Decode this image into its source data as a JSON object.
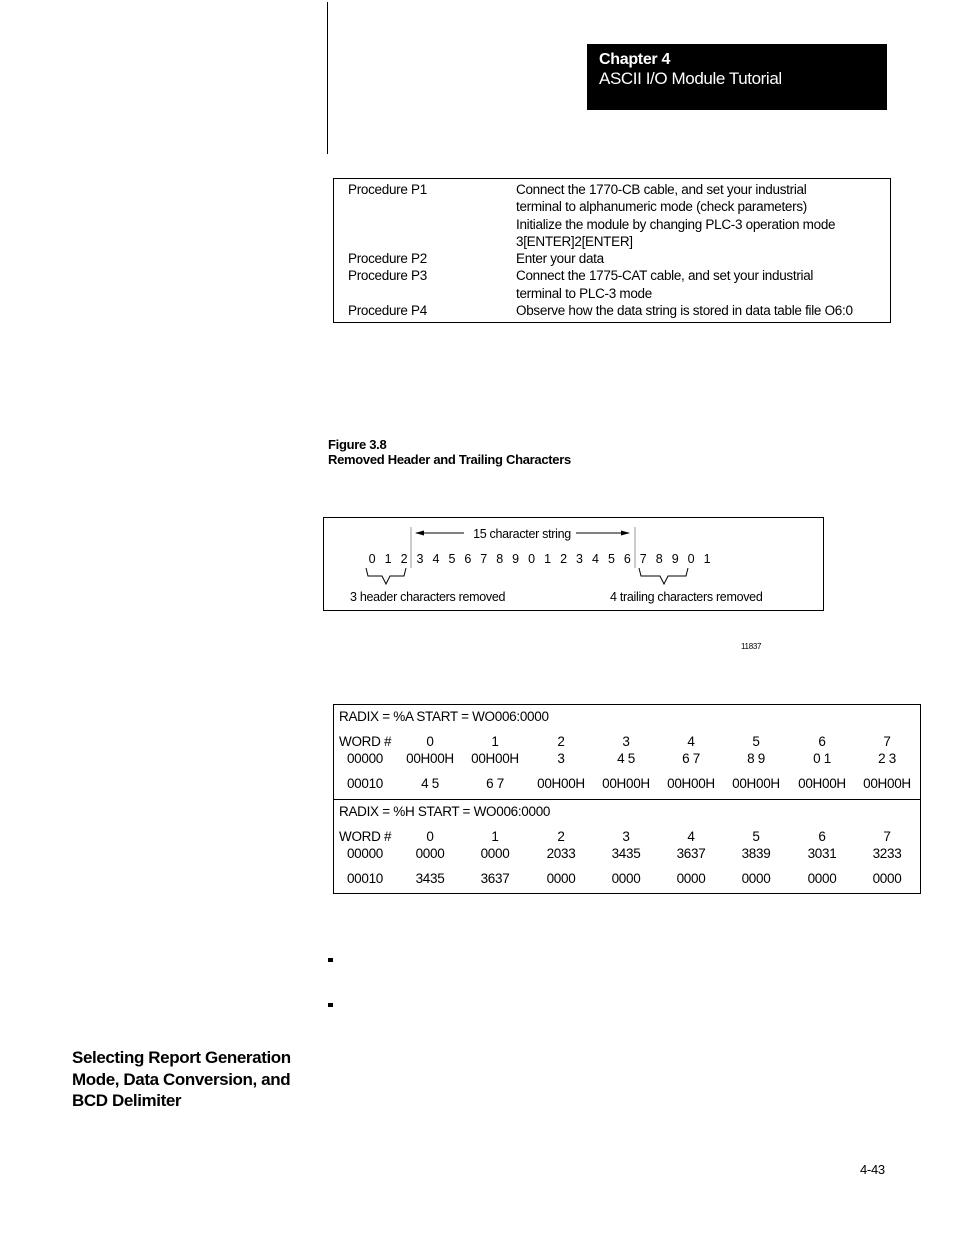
{
  "header": {
    "chapter": "Chapter 4",
    "title": "ASCII I/O Module Tutorial"
  },
  "procedures": [
    {
      "label": "Procedure P1",
      "lines": [
        "Connect the 1770-CB cable, and set your industrial",
        "terminal to alphanumeric mode (check parameters)",
        "Initialize the module by changing PLC-3 operation mode",
        "3[ENTER]2[ENTER]"
      ]
    },
    {
      "label": "Procedure P2",
      "lines": [
        "Enter your data"
      ]
    },
    {
      "label": "Procedure P3",
      "lines": [
        "Connect the 1775-CAT cable, and set your industrial",
        "terminal to PLC-3 mode"
      ]
    },
    {
      "label": "Procedure P4",
      "lines": [
        "Observe how the data string is stored in data table file O6:0"
      ]
    }
  ],
  "figure": {
    "number": "Figure 3.8",
    "caption": "Removed Header and Trailing Characters",
    "string_label": "15 character string",
    "characters": [
      "0",
      "1",
      "2",
      "3",
      "4",
      "5",
      "6",
      "7",
      "8",
      "9",
      "0",
      "1",
      "2",
      "3",
      "4",
      "5",
      "6",
      "7",
      "8",
      "9",
      "0",
      "1"
    ],
    "header_removed_count": 3,
    "trailing_removed_count": 4,
    "header_label": "3 header characters removed",
    "trailing_label": "4 trailing characters removed",
    "figure_id": "11837"
  },
  "radix_tables": [
    {
      "heading": "RADIX = %A  START = WO006:0000",
      "word_label": "WORD #",
      "columns": [
        "0",
        "1",
        "2",
        "3",
        "4",
        "5",
        "6",
        "7"
      ],
      "rows": [
        {
          "word": "00000",
          "values": [
            "00H00H",
            "00H00H",
            "3",
            "4 5",
            "6 7",
            "8 9",
            "0 1",
            "2 3"
          ]
        },
        {
          "word": "00010",
          "values": [
            "4 5",
            "6 7",
            "00H00H",
            "00H00H",
            "00H00H",
            "00H00H",
            "00H00H",
            "00H00H"
          ]
        }
      ]
    },
    {
      "heading": "RADIX = %H  START = WO006:0000",
      "word_label": "WORD #",
      "columns": [
        "0",
        "1",
        "2",
        "3",
        "4",
        "5",
        "6",
        "7"
      ],
      "rows": [
        {
          "word": "00000",
          "values": [
            "0000",
            "0000",
            "2033",
            "3435",
            "3637",
            "3839",
            "3031",
            "3233"
          ]
        },
        {
          "word": "00010",
          "values": [
            "3435",
            "3637",
            "0000",
            "0000",
            "0000",
            "0000",
            "0000",
            "0000"
          ]
        }
      ]
    }
  ],
  "section_heading": [
    "Selecting Report Generation",
    "Mode, Data Conversion, and",
    "BCD Delimiter"
  ],
  "page_number": "4-43"
}
